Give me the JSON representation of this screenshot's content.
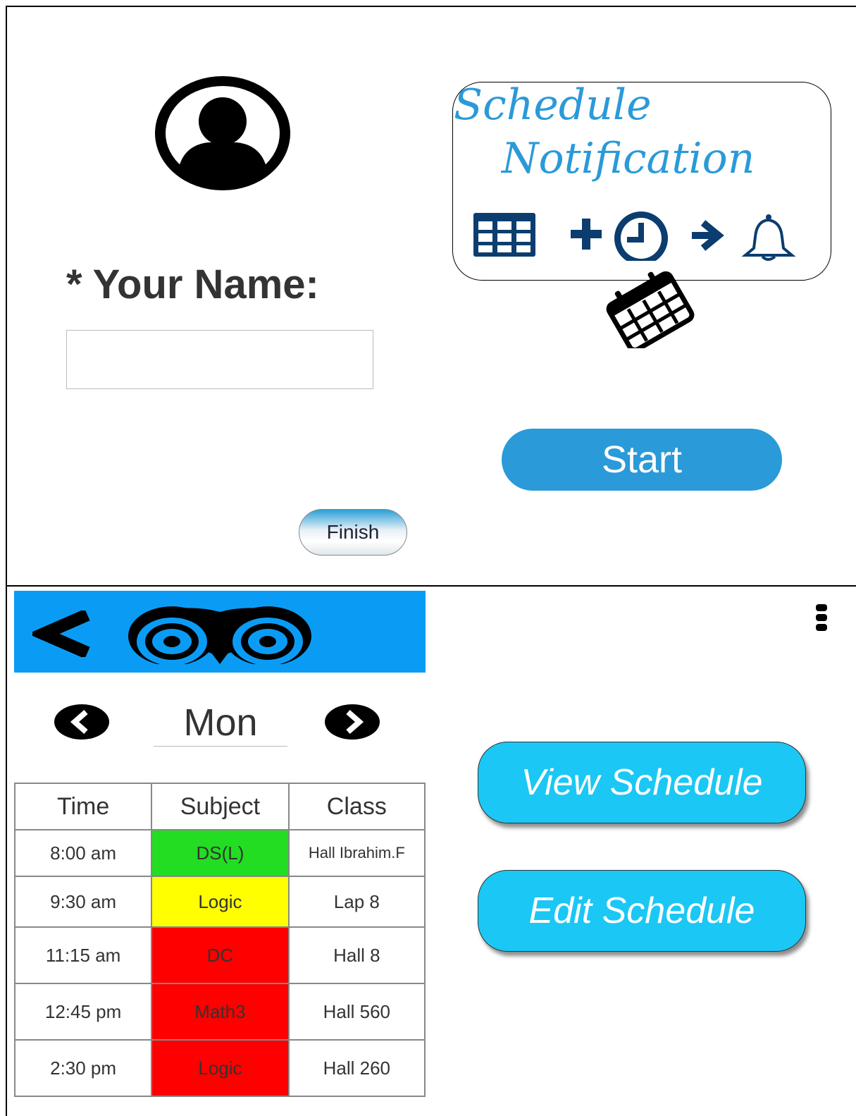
{
  "name_screen": {
    "label": "* Your Name:",
    "name_input_value": "",
    "finish_label": "Finish"
  },
  "welcome_screen": {
    "logo_line1": "Schedule",
    "logo_line2": "Notification",
    "start_label": "Start",
    "icons": [
      "table-icon",
      "plus-icon",
      "clock-icon",
      "arrow-right-icon",
      "bell-icon",
      "calendar-icon"
    ]
  },
  "schedule_screen": {
    "day": "Mon",
    "headers": {
      "time": "Time",
      "subject": "Subject",
      "class": "Class"
    },
    "rows": [
      {
        "time": "8:00 am",
        "subject": "DS(L)",
        "class": "Hall Ibrahim.F",
        "color": "#22dd22",
        "height": 66
      },
      {
        "time": "9:30 am",
        "subject": "Logic",
        "class": "Lap 8",
        "color": "#ffff00",
        "height": 72
      },
      {
        "time": "11:15 am",
        "subject": "DC",
        "class": "Hall 8",
        "color": "#ff0000",
        "height": 80
      },
      {
        "time": "12:45 pm",
        "subject": "Math3",
        "class": "Hall 560",
        "color": "#ff0000",
        "height": 80
      },
      {
        "time": "2:30 pm",
        "subject": "Logic",
        "class": "Hall 260",
        "color": "#ff0000",
        "height": 80
      }
    ],
    "accent": "#0a9cf5"
  },
  "menu_screen": {
    "view_label": "View Schedule",
    "edit_label": "Edit Schedule",
    "accent": "#1bc7f4"
  }
}
